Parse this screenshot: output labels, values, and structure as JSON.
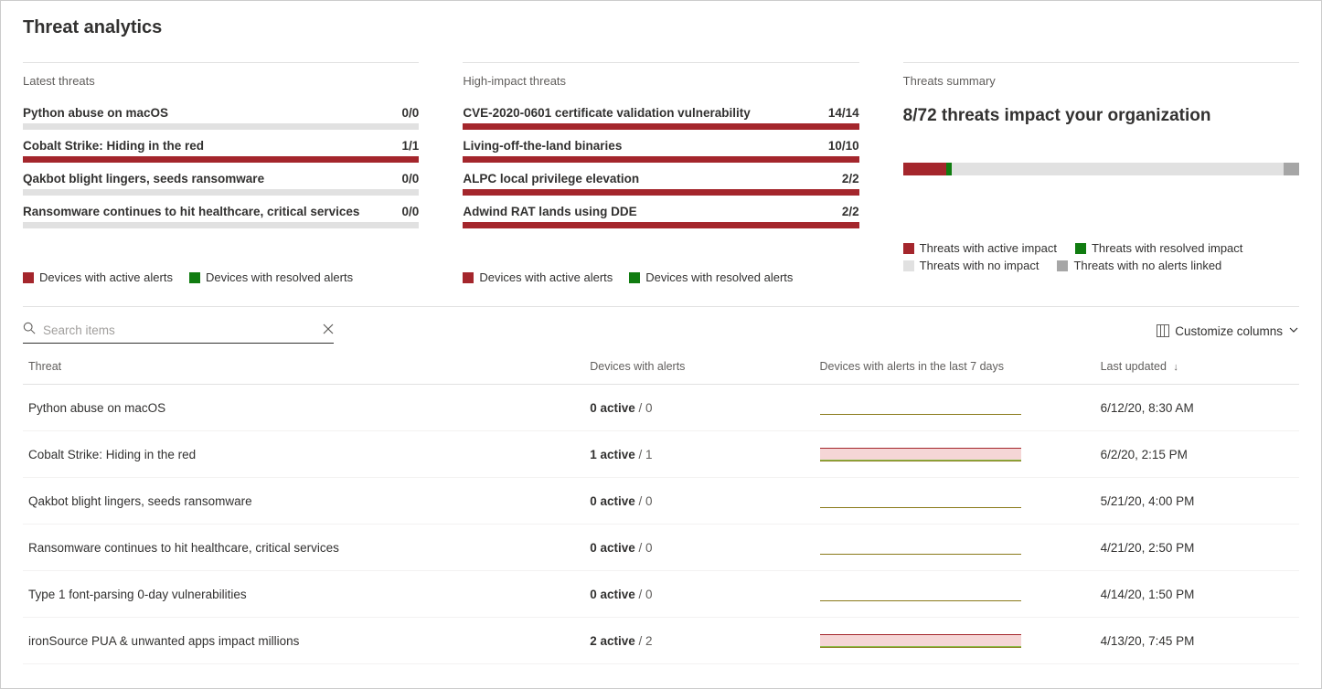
{
  "title": "Threat analytics",
  "panels": {
    "latest": {
      "title": "Latest threats",
      "items": [
        {
          "name": "Python abuse on macOS",
          "ratio": "0/0",
          "fill": 0
        },
        {
          "name": "Cobalt Strike: Hiding in the red",
          "ratio": "1/1",
          "fill": 100
        },
        {
          "name": "Qakbot blight lingers, seeds ransomware",
          "ratio": "0/0",
          "fill": 0
        },
        {
          "name": "Ransomware continues to hit healthcare, critical services",
          "ratio": "0/0",
          "fill": 0
        }
      ],
      "legend": {
        "active": "Devices with active alerts",
        "resolved": "Devices with resolved alerts"
      }
    },
    "high_impact": {
      "title": "High-impact threats",
      "items": [
        {
          "name": "CVE-2020-0601 certificate validation vulnerability",
          "ratio": "14/14",
          "fill": 100
        },
        {
          "name": "Living-off-the-land binaries",
          "ratio": "10/10",
          "fill": 100
        },
        {
          "name": "ALPC local privilege elevation",
          "ratio": "2/2",
          "fill": 100
        },
        {
          "name": "Adwind RAT lands using DDE",
          "ratio": "2/2",
          "fill": 100
        }
      ],
      "legend": {
        "active": "Devices with active alerts",
        "resolved": "Devices with resolved alerts"
      }
    },
    "summary": {
      "title": "Threats summary",
      "headline": "8/72 threats impact your organization",
      "segments": {
        "active": 11,
        "resolved": 1.3,
        "noimpact": 83.7,
        "noalerts": 4
      },
      "legend": {
        "active": "Threats with active impact",
        "resolved": "Threats with resolved impact",
        "noimpact": "Threats with no impact",
        "noalerts": "Threats with no alerts linked"
      }
    }
  },
  "search": {
    "placeholder": "Search items"
  },
  "customize_label": "Customize columns",
  "table": {
    "headers": {
      "threat": "Threat",
      "devices_alerts": "Devices with alerts",
      "devices_7d": "Devices with alerts in the last 7 days",
      "last_updated": "Last updated"
    },
    "rows": [
      {
        "threat": "Python abuse on macOS",
        "active": "0 active",
        "total": " / 0",
        "spark": "flat",
        "updated": "6/12/20, 8:30 AM"
      },
      {
        "threat": "Cobalt Strike: Hiding in the red",
        "active": "1 active",
        "total": " / 1",
        "spark": "area",
        "updated": "6/2/20, 2:15 PM"
      },
      {
        "threat": "Qakbot blight lingers, seeds ransomware",
        "active": "0 active",
        "total": " / 0",
        "spark": "flat",
        "updated": "5/21/20, 4:00 PM"
      },
      {
        "threat": "Ransomware continues to hit healthcare, critical services",
        "active": "0 active",
        "total": " / 0",
        "spark": "flat",
        "updated": "4/21/20, 2:50 PM"
      },
      {
        "threat": "Type 1 font-parsing 0-day vulnerabilities",
        "active": "0 active",
        "total": " / 0",
        "spark": "flat",
        "updated": "4/14/20, 1:50 PM"
      },
      {
        "threat": "ironSource PUA & unwanted apps impact millions",
        "active": "2 active",
        "total": " / 2",
        "spark": "area",
        "updated": "4/13/20, 7:45 PM"
      }
    ]
  },
  "chart_data": [
    {
      "type": "bar",
      "title": "Latest threats — device alert ratio",
      "categories": [
        "Python abuse on macOS",
        "Cobalt Strike: Hiding in the red",
        "Qakbot blight lingers, seeds ransomware",
        "Ransomware continues to hit healthcare, critical services"
      ],
      "series": [
        {
          "name": "active",
          "values": [
            0,
            1,
            0,
            0
          ]
        },
        {
          "name": "total",
          "values": [
            0,
            1,
            0,
            0
          ]
        }
      ]
    },
    {
      "type": "bar",
      "title": "High-impact threats — device alert ratio",
      "categories": [
        "CVE-2020-0601 certificate validation vulnerability",
        "Living-off-the-land binaries",
        "ALPC local privilege elevation",
        "Adwind RAT lands using DDE"
      ],
      "series": [
        {
          "name": "active",
          "values": [
            14,
            10,
            2,
            2
          ]
        },
        {
          "name": "total",
          "values": [
            14,
            10,
            2,
            2
          ]
        }
      ]
    },
    {
      "type": "bar",
      "title": "Threats summary",
      "categories": [
        "active impact",
        "resolved impact",
        "no impact",
        "no alerts linked"
      ],
      "values": [
        8,
        1,
        60,
        3
      ],
      "annotations": [
        "8/72 threats impact your organization"
      ]
    }
  ]
}
